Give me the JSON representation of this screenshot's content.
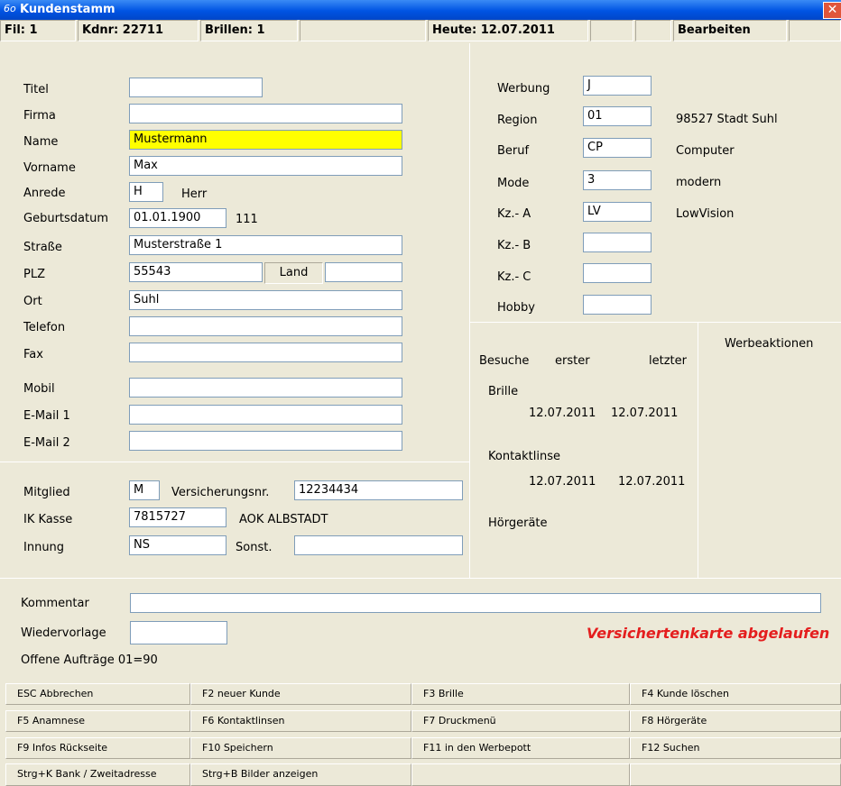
{
  "window": {
    "title": "Kundenstamm",
    "close_glyph": "✕",
    "app_icon_text": "6o"
  },
  "status": {
    "fil": "Fil: 1",
    "kdnr": "Kdnr: 22711",
    "brillen": "Brillen: 1",
    "heute": "Heute: 12.07.2011",
    "mode": "Bearbeiten"
  },
  "personal": {
    "titel_label": "Titel",
    "titel": "",
    "firma_label": "Firma",
    "firma": "",
    "name_label": "Name",
    "name": "Mustermann",
    "vorname_label": "Vorname",
    "vorname": "Max",
    "anrede_label": "Anrede",
    "anrede": "H",
    "anrede_text": "Herr",
    "geburt_label": "Geburtsdatum",
    "geburt": "01.01.1900",
    "geburt_code": "111",
    "strasse_label": "Straße",
    "strasse": "Musterstraße 1",
    "plz_label": "PLZ",
    "plz": "55543",
    "land_label": "Land",
    "land": "",
    "ort_label": "Ort",
    "ort": "Suhl",
    "telefon_label": "Telefon",
    "telefon": "",
    "fax_label": "Fax",
    "fax": "",
    "mobil_label": "Mobil",
    "mobil": "",
    "email1_label": "E-Mail 1",
    "email1": "",
    "email2_label": "E-Mail 2",
    "email2": ""
  },
  "insurance": {
    "mitglied_label": "Mitglied",
    "mitglied": "M",
    "vers_label": "Versicherungsnr.",
    "vers": "12234434",
    "ik_label": "IK Kasse",
    "ik": "7815727",
    "ik_text": "AOK ALBSTADT",
    "innung_label": "Innung",
    "innung": "NS",
    "sonst_label": "Sonst.",
    "sonst": ""
  },
  "marketing": {
    "werbung_label": "Werbung",
    "werbung": "J",
    "region_label": "Region",
    "region": "01",
    "region_text": "98527 Stadt Suhl",
    "beruf_label": "Beruf",
    "beruf": "CP",
    "beruf_text": "Computer",
    "mode_label": "Mode",
    "mode": "3",
    "mode_text": "modern",
    "kza_label": "Kz.- A",
    "kza": "LV",
    "kza_text": "LowVision",
    "kzb_label": "Kz.- B",
    "kzb": "",
    "kzc_label": "Kz.- C",
    "kzc": "",
    "hobby_label": "Hobby",
    "hobby": ""
  },
  "visits": {
    "besuche": "Besuche",
    "erster": "erster",
    "letzter": "letzter",
    "werbeaktionen": "Werbeaktionen",
    "brille_label": "Brille",
    "brille_first": "12.07.2011",
    "brille_last": "12.07.2011",
    "kontakt_label": "Kontaktlinse",
    "kontakt_first": "12.07.2011",
    "kontakt_last": "12.07.2011",
    "hoer_label": "Hörgeräte"
  },
  "footer": {
    "kommentar_label": "Kommentar",
    "kommentar": "",
    "wieder_label": "Wiedervorlage",
    "wieder": "",
    "offene": "Offene Aufträge 01=90",
    "warning": "Versichertenkarte abgelaufen"
  },
  "fkeys": [
    "ESC Abbrechen",
    "F2 neuer Kunde",
    "F3 Brille",
    "F4 Kunde löschen",
    "F5 Anamnese",
    "F6 Kontaktlinsen",
    "F7 Druckmenü",
    "F8 Hörgeräte",
    "F9 Infos Rückseite",
    "F10 Speichern",
    "F11 in den Werbepott",
    "F12 Suchen",
    "Strg+K Bank / Zweitadresse",
    "Strg+B Bilder anzeigen",
    "",
    ""
  ],
  "colors": {
    "title_bar": "#0054e3",
    "highlight_field": "#ffff00",
    "warning": "#e41e1e",
    "window_bg": "#ece9d8"
  }
}
